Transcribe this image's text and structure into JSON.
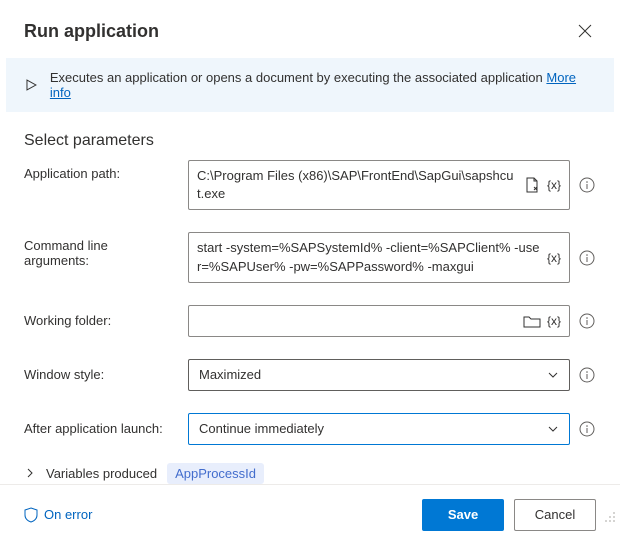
{
  "header": {
    "title": "Run application"
  },
  "info": {
    "text": "Executes an application or opens a document by executing the associated application",
    "link": "More info"
  },
  "section": {
    "title": "Select parameters"
  },
  "params": {
    "appPath": {
      "label": "Application path:",
      "value": "C:\\Program Files (x86)\\SAP\\FrontEnd\\SapGui\\sapshcut.exe"
    },
    "cmdArgs": {
      "label": "Command line arguments:",
      "value": "start -system=%SAPSystemId% -client=%SAPClient% -user=%SAPUser% -pw=%SAPPassword% -maxgui"
    },
    "workingFolder": {
      "label": "Working folder:",
      "value": ""
    },
    "windowStyle": {
      "label": "Window style:",
      "value": "Maximized"
    },
    "afterLaunch": {
      "label": "After application launch:",
      "value": "Continue immediately"
    }
  },
  "variables": {
    "label": "Variables produced",
    "pill": "AppProcessId"
  },
  "tokens": {
    "var": "{x}"
  },
  "footer": {
    "onError": "On error",
    "save": "Save",
    "cancel": "Cancel"
  }
}
